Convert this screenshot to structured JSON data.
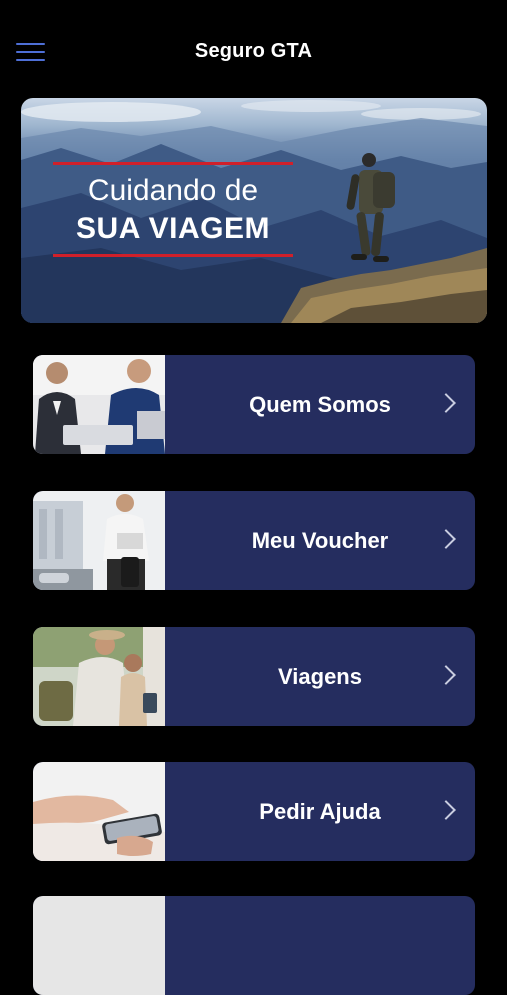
{
  "header": {
    "title": "Seguro GTA",
    "menu_icon": "hamburger-menu-icon",
    "menu_icon_color": "#4e6fd6"
  },
  "hero": {
    "line1": "Cuidando de",
    "line2": "SUA VIAGEM",
    "accent_color": "#d0202a"
  },
  "menu": {
    "card_color": "#252d5f",
    "items": [
      {
        "label": "Quem Somos",
        "icon": "chevron-right-icon"
      },
      {
        "label": "Meu Voucher",
        "icon": "chevron-right-icon"
      },
      {
        "label": "Viagens",
        "icon": "chevron-right-icon"
      },
      {
        "label": "Pedir Ajuda",
        "icon": "chevron-right-icon"
      }
    ]
  }
}
